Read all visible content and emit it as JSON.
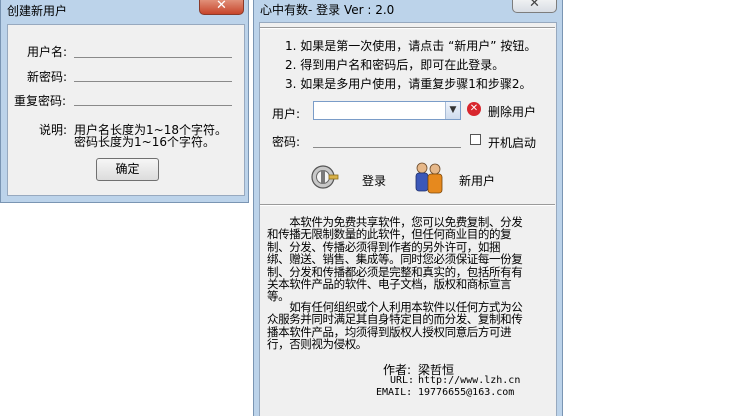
{
  "create_window": {
    "title": "创建新用户",
    "close_glyph": "✕",
    "username_label": "用户名:",
    "new_password_label": "新密码:",
    "repeat_password_label": "重复密码:",
    "note_label": "说明:",
    "note_line1": "用户名长度为1~18个字符。",
    "note_line2": "密码长度为1~16个字符。",
    "ok_button": "确定"
  },
  "login_window": {
    "title": "心中有数- 登录   Ver : 2.0",
    "close_glyph": "✕",
    "steps": [
      "1.  如果是第一次使用，请点击 “新用户” 按钮。",
      "2.  得到用户名和密码后，即可在此登录。",
      "3.  如果是多用户使用，请重复步骤1和步骤2。"
    ],
    "user_label": "用户:",
    "user_value": "",
    "delete_user_label": "删除用户",
    "password_label": "密码:",
    "password_value": "",
    "autostart_label": "开机启动",
    "autostart_checked": false,
    "login_button": "登录",
    "new_user_button": "新用户",
    "notice_para1": [
      "　　本软件为免费共享软件，您可以免费复制、分发",
      "和传播无限制数量的此软件，但任何商业目的的复",
      "制、分发、传播必须得到作者的另外许可，如捆",
      "绑、赠送、销售、集成等。同时您必须保证每一份复",
      "制、分发和传播都必须是完整和真实的，包括所有有",
      "关本软件产品的软件、电子文档，版权和商标宣言",
      "等。"
    ],
    "notice_para2": [
      "　　如有任何组织或个人利用本软件以任何方式为公",
      "众服务并同时满足其自身特定目的而分发、复制和传",
      "播本软件产品，均须得到版权人授权同意后方可进",
      "行，否则视为侵权。"
    ],
    "author_label": "作者:",
    "author_name": "梁哲恒",
    "url_label": "URL:",
    "url_value": "http://www.lzh.cn",
    "email_label": "EMAIL:",
    "email_value": "19776655@163.com"
  },
  "colors": {
    "frame": "#bcd3ea",
    "client": "#f0f0f0",
    "close_red": "#c7452b",
    "delete_red": "#d8262d"
  }
}
